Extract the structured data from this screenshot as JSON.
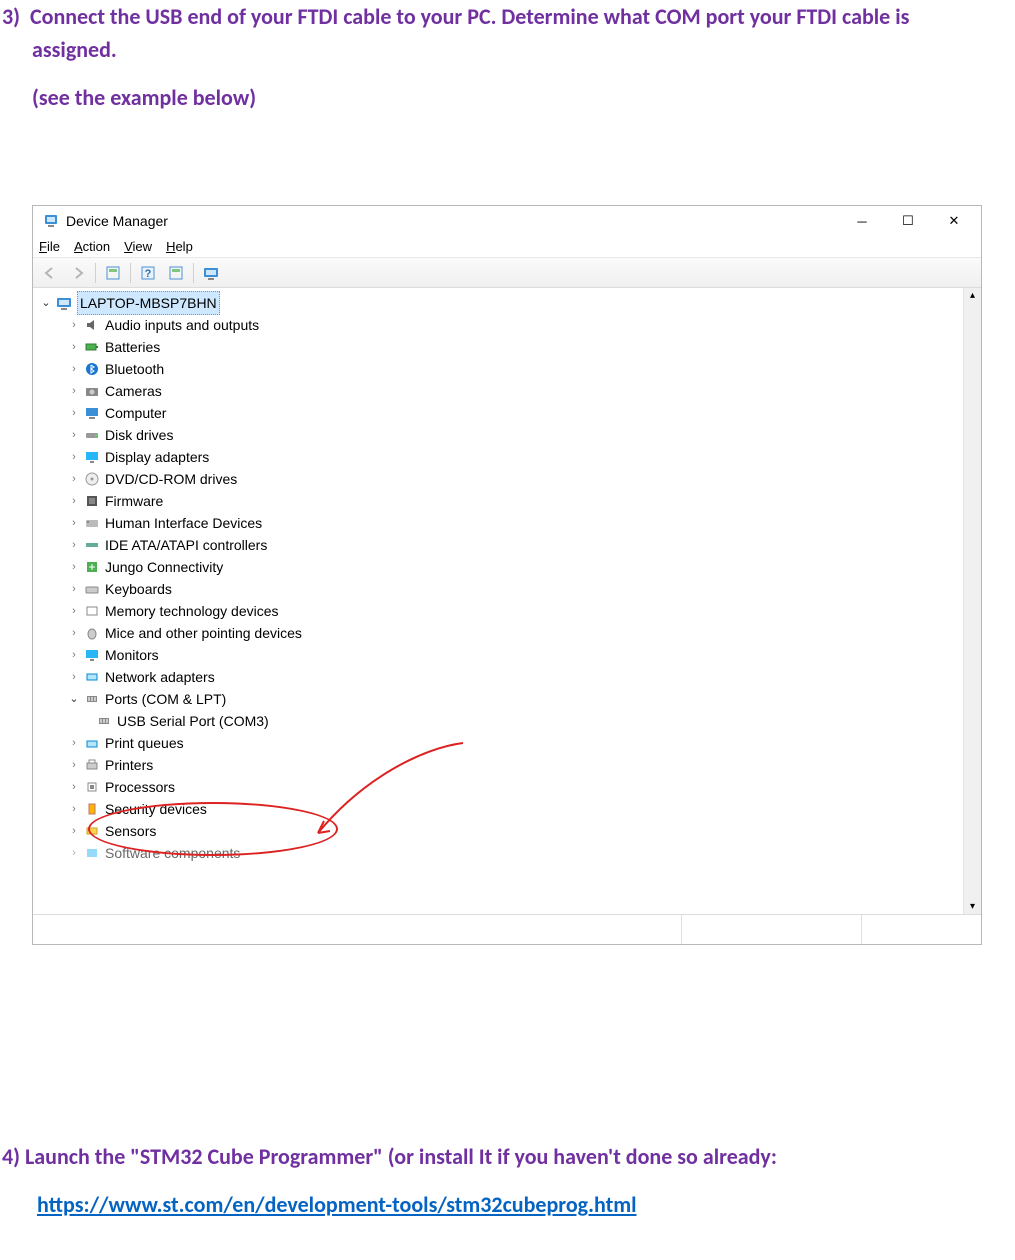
{
  "step3": {
    "number": "3)",
    "text": "Connect the USB end of your FTDI cable to your PC.  Determine what COM port your FTDI cable is assigned.",
    "subtext": "(see the example below)"
  },
  "step4": {
    "number": "4)",
    "text": "Launch the \"STM32 Cube Programmer\" (or install It if you haven't done so already:",
    "url": "https://www.st.com/en/development-tools/stm32cubeprog.html"
  },
  "device_manager": {
    "title": "Device Manager",
    "menu": {
      "file": "File",
      "action": "Action",
      "view": "View",
      "help": "Help"
    },
    "root": "LAPTOP-MBSP7BHN",
    "nodes": {
      "audio": "Audio inputs and outputs",
      "batteries": "Batteries",
      "bluetooth": "Bluetooth",
      "cameras": "Cameras",
      "computer": "Computer",
      "disk": "Disk drives",
      "display": "Display adapters",
      "dvd": "DVD/CD-ROM drives",
      "firmware": "Firmware",
      "hid": "Human Interface Devices",
      "ide": "IDE ATA/ATAPI controllers",
      "jungo": "Jungo Connectivity",
      "keyboards": "Keyboards",
      "memory": "Memory technology devices",
      "mice": "Mice and other pointing devices",
      "monitors": "Monitors",
      "network": "Network adapters",
      "ports": "Ports (COM & LPT)",
      "usb_serial": "USB Serial Port (COM3)",
      "printq": "Print queues",
      "printers": "Printers",
      "processors": "Processors",
      "security": "Security devices",
      "sensors": "Sensors",
      "software": "Software components"
    }
  }
}
